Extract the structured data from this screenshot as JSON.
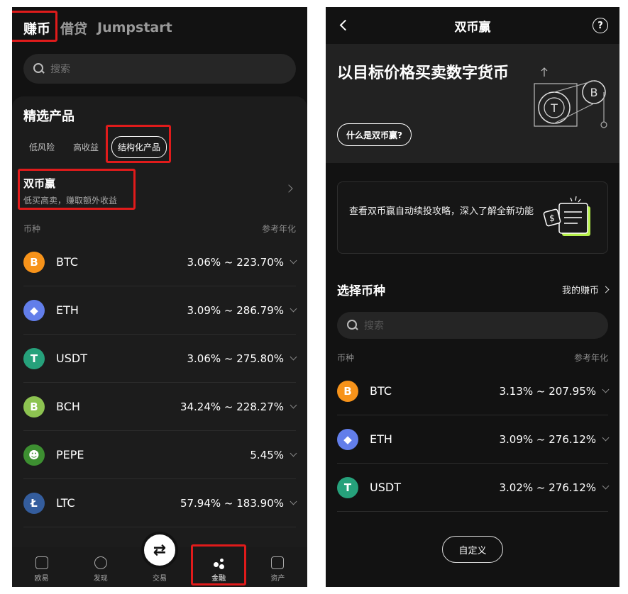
{
  "left": {
    "top_tabs": [
      "赚币",
      "借贷",
      "Jumpstart"
    ],
    "search_placeholder": "搜索",
    "section_title": "精选产品",
    "chips": [
      "低风险",
      "高收益",
      "结构化产品"
    ],
    "product": {
      "name": "双币赢",
      "desc": "低买高卖，赚取额外收益"
    },
    "col_headers": {
      "coin": "币种",
      "apr": "参考年化"
    },
    "coins": [
      {
        "symbol": "BTC",
        "rate": "3.06% ~ 223.70%",
        "icon_glyph": "B",
        "color": "#f7931a"
      },
      {
        "symbol": "ETH",
        "rate": "3.09% ~ 286.79%",
        "icon_glyph": "◆",
        "color": "#627eea"
      },
      {
        "symbol": "USDT",
        "rate": "3.06% ~ 275.80%",
        "icon_glyph": "T",
        "color": "#26a17b"
      },
      {
        "symbol": "BCH",
        "rate": "34.24% ~ 228.27%",
        "icon_glyph": "B",
        "color": "#8dc351"
      },
      {
        "symbol": "PEPE",
        "rate": "5.45%",
        "icon_glyph": "☻",
        "color": "#3d8f31"
      },
      {
        "symbol": "LTC",
        "rate": "57.94% ~ 183.90%",
        "icon_glyph": "Ł",
        "color": "#345d9d"
      }
    ],
    "bottom_nav": [
      "欧易",
      "发现",
      "交易",
      "金融",
      "资产"
    ],
    "active_nav": "金融"
  },
  "right": {
    "title": "双币赢",
    "hero_title": "以目标价格买卖数字货币",
    "hero_button": "什么是双币赢?",
    "guide_text": "查看双币赢自动续投攻略，深入了解全新功能",
    "section_title": "选择币种",
    "my_earn_link": "我的赚币",
    "search_placeholder": "搜索",
    "col_headers": {
      "coin": "币种",
      "apr": "参考年化"
    },
    "coins": [
      {
        "symbol": "BTC",
        "rate": "3.13% ~ 207.95%",
        "icon_glyph": "B",
        "color": "#f7931a"
      },
      {
        "symbol": "ETH",
        "rate": "3.09% ~ 276.12%",
        "icon_glyph": "◆",
        "color": "#627eea"
      },
      {
        "symbol": "USDT",
        "rate": "3.02% ~ 276.12%",
        "icon_glyph": "T",
        "color": "#26a17b"
      }
    ],
    "customize_button": "自定义"
  },
  "colors": {
    "highlight_red": "#e01b1b",
    "accent_green": "#b6f04a"
  }
}
